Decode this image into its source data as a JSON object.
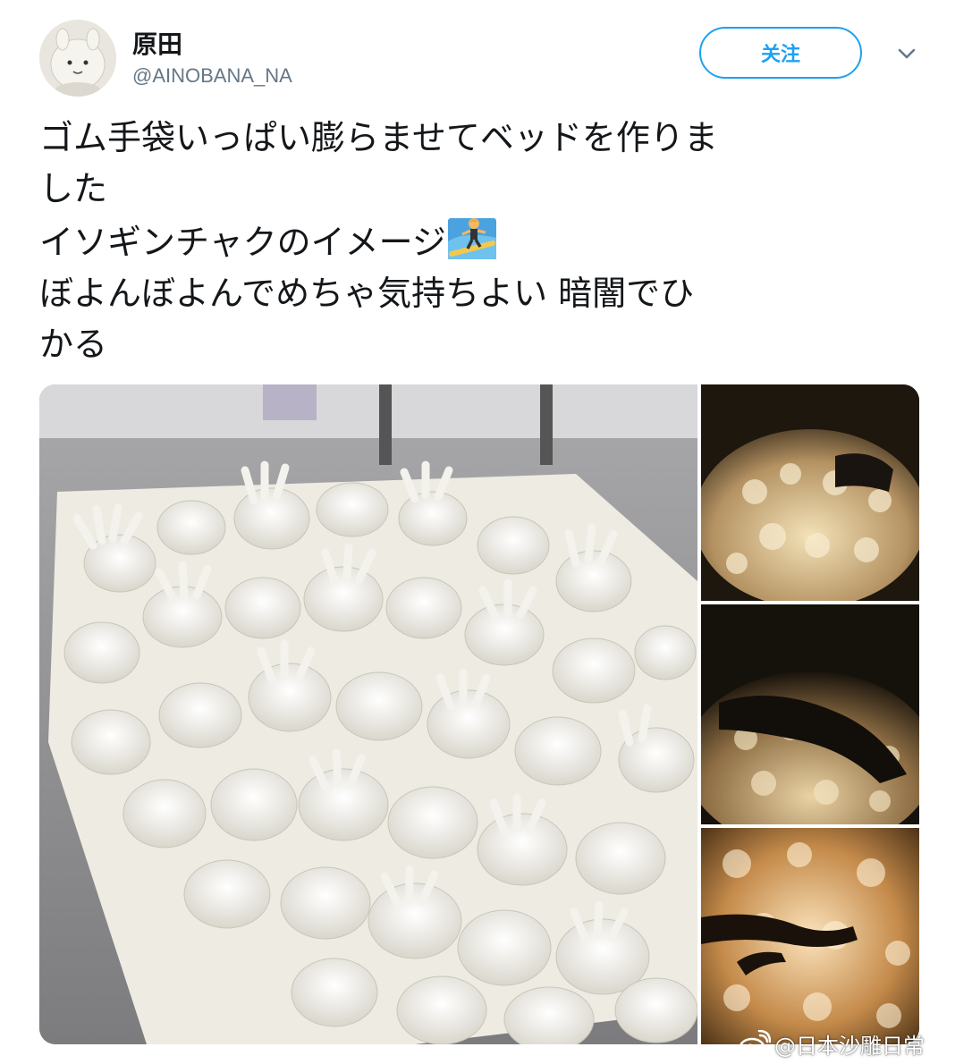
{
  "tweet": {
    "user": {
      "display_name": "原田",
      "handle": "@AINOBANA_NA"
    },
    "follow_label": "关注",
    "text_lines": [
      "ゴム手袋いっぱい膨らませてベッドを作りま",
      "した",
      "イソギンチャクのイメージ",
      "ぼよんぼよんでめちゃ気持ちよい  暗闇でひ",
      "かる"
    ],
    "emoji": "surfer-emoji"
  },
  "watermark": {
    "text": "@日本沙雕日常",
    "icon": "weibo-icon"
  },
  "colors": {
    "accent": "#1da1f2",
    "text": "#14171a",
    "secondary": "#657786"
  }
}
